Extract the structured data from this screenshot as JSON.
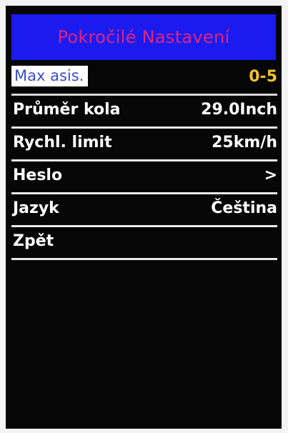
{
  "header": {
    "title": "Pokročilé Nastavení"
  },
  "menu": {
    "items": [
      {
        "label": "Max asis.",
        "value": "0-5"
      },
      {
        "label": "Průměr kola",
        "value": "29.0Inch"
      },
      {
        "label": "Rychl. limit",
        "value": "25km/h"
      },
      {
        "label": "Heslo",
        "value": ">"
      },
      {
        "label": "Jazyk",
        "value": "Čeština"
      },
      {
        "label": "Zpět",
        "value": ""
      }
    ],
    "selected_index": 0
  },
  "colors": {
    "header_bg": "#1b1bf0",
    "header_text": "#e0247c",
    "screen_bg": "#060606",
    "selected_label_text": "#3a4fc9",
    "selected_value_text": "#f4c329",
    "item_text": "#ffffff",
    "divider": "#e9e9e9"
  }
}
